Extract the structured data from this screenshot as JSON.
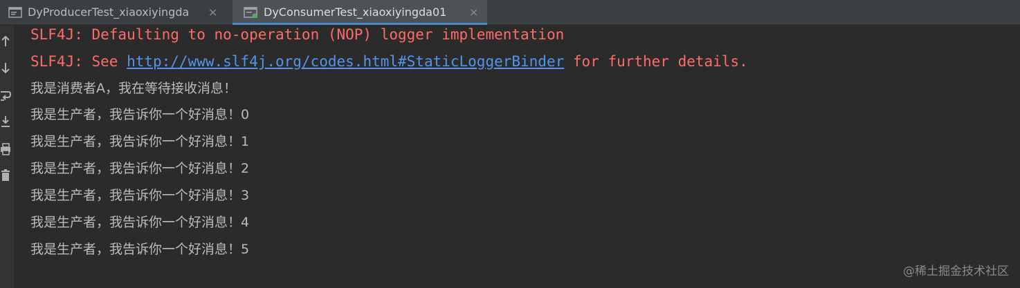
{
  "tabs": [
    {
      "label": "DyProducerTest_xiaoxiyingda",
      "close": "×",
      "active": false
    },
    {
      "label": "DyConsumerTest_xiaoxiyingda01",
      "close": "×",
      "active": true
    }
  ],
  "console": {
    "line1": "SLF4J: Defaulting to no-operation (NOP) logger implementation",
    "line2_prefix": "SLF4J: See ",
    "line2_link": "http://www.slf4j.org/codes.html#StaticLoggerBinder",
    "line2_suffix": " for further details.",
    "consumer_line": "我是消费者A，我在等待接收消息！",
    "producer_lines": [
      "我是生产者，我告诉你一个好消息！0",
      "我是生产者，我告诉你一个好消息！1",
      "我是生产者，我告诉你一个好消息！2",
      "我是生产者，我告诉你一个好消息！3",
      "我是生产者，我告诉你一个好消息！4",
      "我是生产者，我告诉你一个好消息！5"
    ]
  },
  "watermark": "@稀土掘金技术社区",
  "colors": {
    "background": "#2b2b2b",
    "error_text": "#ff6b68",
    "link": "#5394ec",
    "output_text": "#bbbbbb",
    "active_tab_underline": "#4a88c7"
  },
  "icons": {
    "tab_icon": "run-console-icon",
    "toolbar": [
      "scroll-up-icon",
      "scroll-down-icon",
      "soft-wrap-icon",
      "scroll-to-end-icon",
      "print-icon",
      "trash-icon"
    ]
  }
}
